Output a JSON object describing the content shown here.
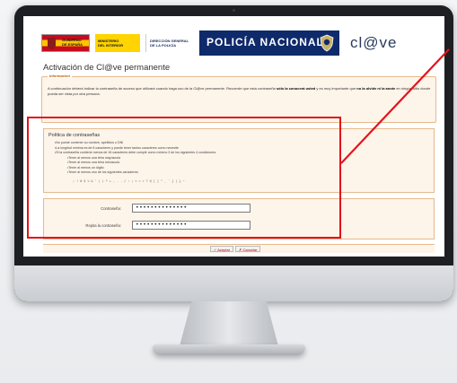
{
  "banner": {
    "gob_line1": "GOBIERNO",
    "gob_line2": "DE ESPAÑA",
    "min_line1": "MINISTERIO",
    "min_line2": "DEL INTERIOR",
    "dg_line1": "DIRECCIÓN GENERAL",
    "dg_line2": "DE LA POLICÍA",
    "policia": "POLICÍA NACIONAL",
    "clave": "cl@ve"
  },
  "page": {
    "title": "Activación de Cl@ve permanente"
  },
  "info": {
    "legend": "Información",
    "text_part1": "A continuación deberá indicar la contraseña de acceso que utilizará cuando haga uso de la Cl@ve permanente. Recuerde que esta contraseña ",
    "text_bold1": "sólo la conocerá usted",
    "text_part2": " y es muy importante que ",
    "text_bold2": "no la olvide ni la anote",
    "text_part3": " en ningún sitio donde pueda ser vista por otra persona."
  },
  "policy": {
    "title": "Política de contraseñas",
    "rules": [
      "No puede contener su nombre, apellidos o DNI",
      "La longitud mínima es de 8 caracteres y puede tener tantos caracteres como necesite",
      "Si la contraseña contiene menos de 16 caracteres debe cumplir como mínimo 3 de los siguientes 4 condiciones:"
    ],
    "sub_rules": [
      "Tener al menos una letra mayúscula",
      "Tener al menos una letra minúscula",
      "Tener al menos un dígito",
      "Tener al menos uno de los siguientes caracteres:"
    ],
    "special_chars": "; ! # $ % & ' ( ) * + , - . / : ; < = > ? @ [ ] ^ _ ` { | } ~"
  },
  "form": {
    "password_label": "Contraseña:",
    "password_value": "••••••••••••••",
    "repeat_label": "Repita la contraseña:",
    "repeat_value": "••••••••••••••"
  },
  "buttons": {
    "accept": "Aceptar",
    "cancel": "Cancelar"
  },
  "colors": {
    "annotation": "#e3131b",
    "banner_blue": "#0f2a6b",
    "panel_border": "#e7b98a"
  }
}
